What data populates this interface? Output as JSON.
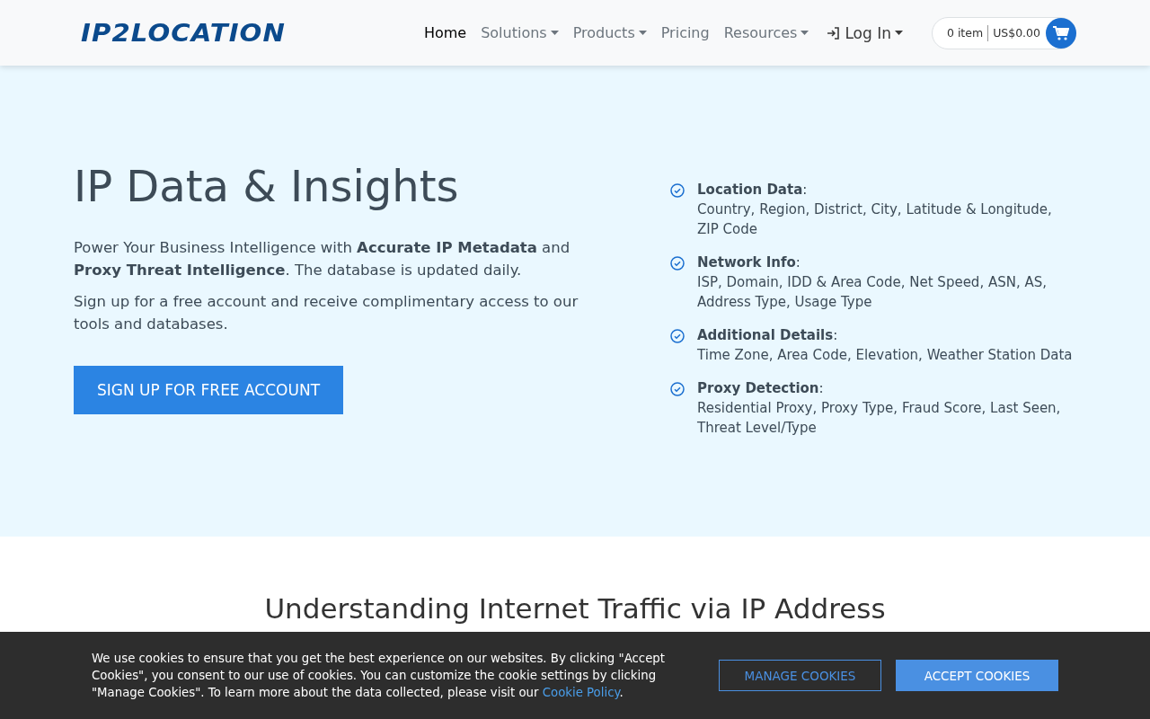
{
  "header": {
    "logo": "IP2LOCATION",
    "nav": [
      {
        "label": "Home",
        "selected": true,
        "dropdown": false,
        "kind": "link"
      },
      {
        "label": "Solutions",
        "selected": false,
        "dropdown": true,
        "kind": "link"
      },
      {
        "label": "Products",
        "selected": false,
        "dropdown": true,
        "kind": "link"
      },
      {
        "label": "Pricing",
        "selected": false,
        "dropdown": false,
        "kind": "link"
      },
      {
        "label": "Resources",
        "selected": false,
        "dropdown": true,
        "kind": "link"
      },
      {
        "label": "Log In",
        "selected": false,
        "dropdown": true,
        "kind": "login"
      }
    ],
    "cart": {
      "items": "0 item",
      "total": "US$0.00"
    }
  },
  "hero": {
    "title": "IP Data & Insights",
    "paragraphs": [
      "Power Your Business Intelligence with **Accurate IP Metadata** and **Proxy Threat Intelligence**. The database is updated daily.",
      "Sign up for a free account and receive complimentary access to our tools and databases."
    ],
    "button": "SIGN UP FOR FREE ACCOUNT",
    "features": [
      {
        "name": "**Location Data**:",
        "details": "Country, Region, District, City, Latitude & Longitude, ZIP Code"
      },
      {
        "name": "**Network Info**:",
        "details": "ISP, Domain, IDD & Area Code, Net Speed, ASN, AS, Address Type, Usage Type"
      },
      {
        "name": "**Additional Details**:",
        "details": "Time Zone, Area Code, Elevation, Weather Station Data"
      },
      {
        "name": "**Proxy Detection**:",
        "details": "Residential Proxy, Proxy Type, Fraud Score, Last Seen, Threat Level/Type"
      }
    ]
  },
  "section": {
    "title": "Understanding Internet Traffic via IP Address"
  },
  "cookie_banner": {
    "text": "We use cookies to ensure that you get the best experience on our websites. By clicking \"Accept Cookies\", you consent to our use of cookies. You can customize the cookie settings by clicking \"Manage Cookies\". To learn more about the data collected, please visit our ",
    "link": "Cookie Policy",
    "text_after": ".",
    "buttons": [
      {
        "label": "MANAGE COOKIES",
        "kind": "outline"
      },
      {
        "label": "ACCEPT COOKIES",
        "kind": "solid"
      }
    ]
  }
}
